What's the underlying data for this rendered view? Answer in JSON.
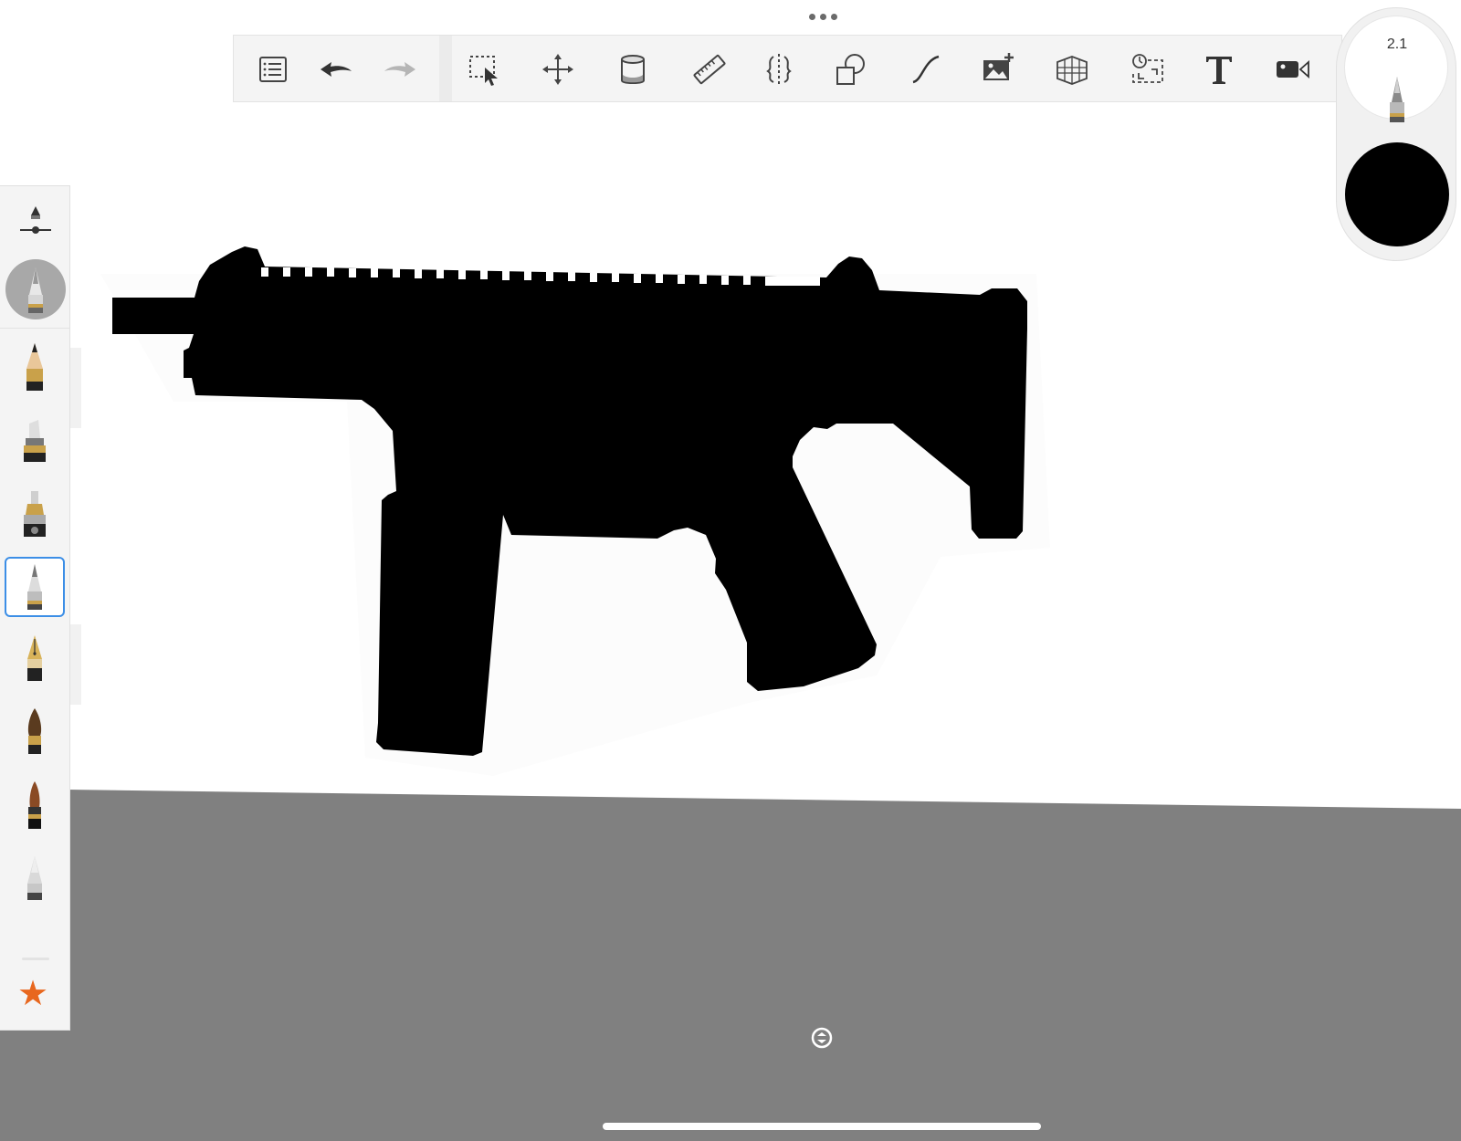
{
  "toolbar": {
    "tools": [
      {
        "name": "brushes-list",
        "icon": "list-icon"
      },
      {
        "name": "undo",
        "icon": "undo-icon"
      },
      {
        "name": "redo",
        "icon": "redo-icon",
        "disabled": true
      },
      {
        "name": "selection",
        "icon": "selection-icon"
      },
      {
        "name": "transform",
        "icon": "move-icon"
      },
      {
        "name": "fill",
        "icon": "paint-bucket-icon"
      },
      {
        "name": "ruler",
        "icon": "ruler-icon"
      },
      {
        "name": "symmetry",
        "icon": "symmetry-icon"
      },
      {
        "name": "shapes",
        "icon": "shapes-icon"
      },
      {
        "name": "curve",
        "icon": "curve-icon"
      },
      {
        "name": "add-image",
        "icon": "add-image-icon"
      },
      {
        "name": "perspective",
        "icon": "perspective-grid-icon"
      },
      {
        "name": "time-lapse",
        "icon": "timelapse-icon"
      },
      {
        "name": "text",
        "icon": "text-icon"
      },
      {
        "name": "record",
        "icon": "video-icon"
      }
    ]
  },
  "puck": {
    "brush_size": "2.1",
    "color": "#000000"
  },
  "palette": {
    "brushes": [
      "pencil",
      "marker",
      "airbrush",
      "technical-pen",
      "fountain-pen",
      "paint-brush",
      "ink-brush",
      "smudge"
    ],
    "selected": "technical-pen",
    "favorites_icon": "star-icon"
  },
  "colors": {
    "canvas": "#ffffff",
    "background": "#808080",
    "accent": "#3c8ee6",
    "star": "#e8671e"
  }
}
